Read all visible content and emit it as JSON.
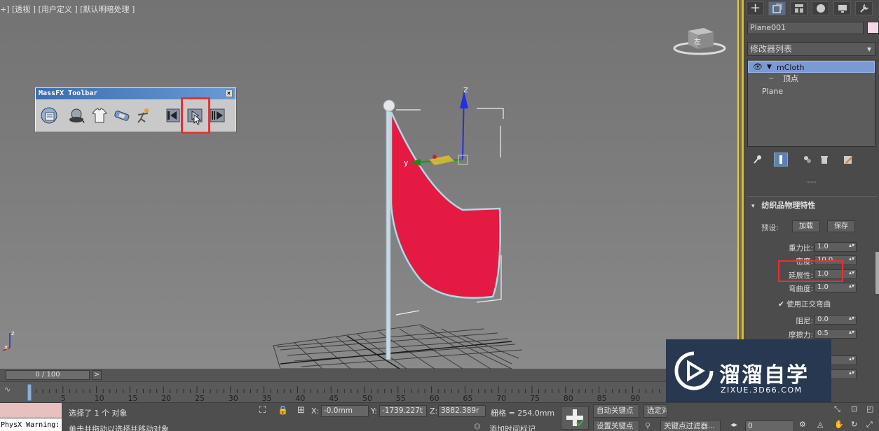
{
  "viewport": {
    "label": "+] [透视 ] [用户定义 ] [默认明暗处理 ]",
    "viewcube_label": "左"
  },
  "massfx": {
    "title": "MassFX Toolbar",
    "close": "×",
    "tools": [
      "world-settings",
      "rigid-body",
      "mcloth",
      "constraint",
      "ragdoll",
      "reset-simulation",
      "play-simulation",
      "step-simulation"
    ]
  },
  "command_panel": {
    "object_name": "Plane001",
    "object_color": "#f4d8e6",
    "modifier_list": "修改器列表",
    "stack": {
      "mcloth": "mCloth",
      "vertex": "顶点",
      "plane": "Plane"
    },
    "rollout": {
      "title": "纺织品物理特性",
      "preset_label": "预设:",
      "load_button": "加载",
      "save_button": "保存",
      "params": [
        {
          "label": "重力比:",
          "value": "1.0"
        },
        {
          "label": "密度:",
          "value": "10.0"
        },
        {
          "label": "延展性:",
          "value": "1.0"
        },
        {
          "label": "弯曲度:",
          "value": "1.0"
        }
      ],
      "ortho_bend_label": "使用正交弯曲",
      "ortho_bend_checked": true,
      "params2": [
        {
          "label": "阻尼:",
          "value": "0.0"
        },
        {
          "label": "摩擦力:",
          "value": "0.5"
        }
      ]
    }
  },
  "timeline": {
    "slider_label": "0 / 100",
    "next": ">",
    "ticks": [
      0,
      5,
      10,
      15,
      20,
      25,
      30,
      35,
      40,
      45,
      50,
      55,
      60,
      65,
      70,
      75,
      80,
      85,
      90
    ]
  },
  "statusbar": {
    "script_text": "PhysX Warning:",
    "message1": "选择了 1 个 对象",
    "message2": "单击并拖动以选择并移动对象",
    "x_label": "X:",
    "x_value": "-0.0mm",
    "y_label": "Y:",
    "y_value": "-1739.227t",
    "z_label": "Z:",
    "z_value": "3882.389r",
    "grid": "栅格 = 254.0mm",
    "add_time_tag": "添加时间标记",
    "auto_key": "自动关键点",
    "set_key": "设置关键点",
    "selected": "选定对",
    "key_filters": "关键点过滤器...",
    "frame": "0"
  },
  "watermark": {
    "title": "溜溜自学",
    "subtitle": "ZIXUE.3D66.COM"
  }
}
